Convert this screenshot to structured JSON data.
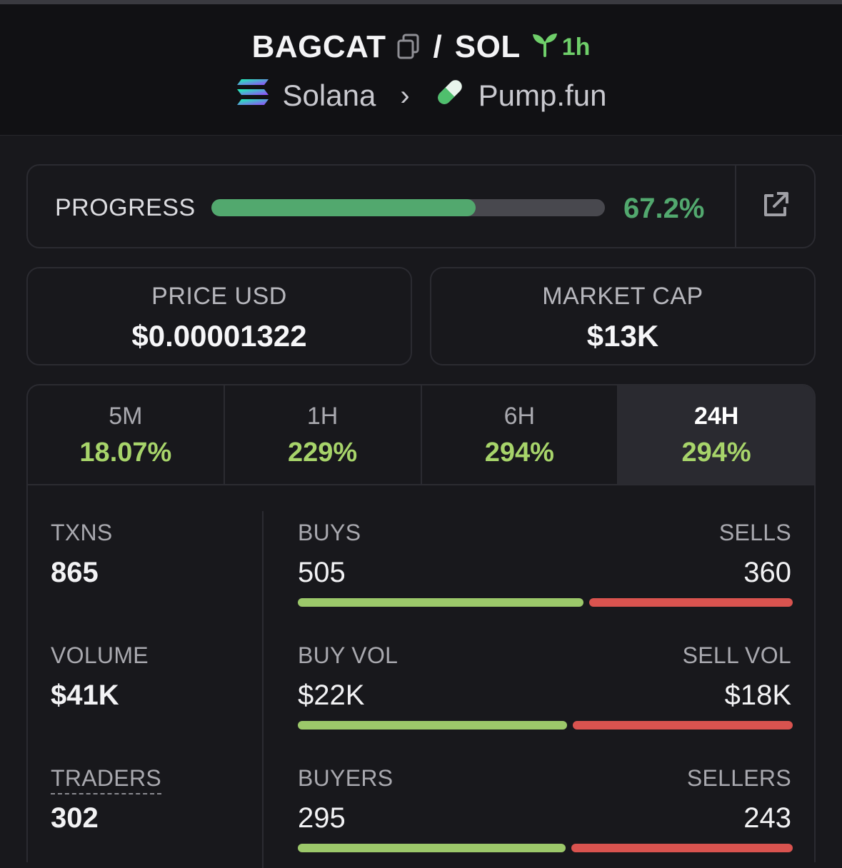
{
  "header": {
    "base_symbol": "BAGCAT",
    "separator": "/",
    "quote_symbol": "SOL",
    "age": "1h",
    "chain": "Solana",
    "dex": "Pump.fun"
  },
  "progress": {
    "label": "PROGRESS",
    "value_text": "67.2%",
    "fraction": 0.672
  },
  "price": {
    "label": "PRICE USD",
    "value": "$0.00001322"
  },
  "market_cap": {
    "label": "MARKET CAP",
    "value": "$13K"
  },
  "periods": [
    {
      "label": "5M",
      "change": "18.07%"
    },
    {
      "label": "1H",
      "change": "229%"
    },
    {
      "label": "6H",
      "change": "294%"
    },
    {
      "label": "24H",
      "change": "294%",
      "active": true
    }
  ],
  "txns": {
    "label": "TXNS",
    "value": "865",
    "buys_label": "BUYS",
    "buys": "505",
    "sells_label": "SELLS",
    "sells": "360",
    "buy_share": 0.584
  },
  "volume": {
    "label": "VOLUME",
    "value": "$41K",
    "buy_label": "BUY VOL",
    "buy": "$22K",
    "sell_label": "SELL VOL",
    "sell": "$18K",
    "buy_share": 0.55
  },
  "traders": {
    "label": "TRADERS",
    "value": "302",
    "buyers_label": "BUYERS",
    "buyers": "295",
    "sellers_label": "SELLERS",
    "sellers": "243",
    "buy_share": 0.548
  },
  "colors": {
    "progress_green": "#52a86e",
    "change_green": "#a7d46a",
    "buy_bar": "#9cc86a",
    "sell_bar": "#d9534f",
    "age_green": "#6fcf6a"
  },
  "icons": [
    "copy-icon",
    "seedling-icon",
    "solana-logo-icon",
    "chevron-right-icon",
    "pill-icon",
    "external-link-icon"
  ]
}
